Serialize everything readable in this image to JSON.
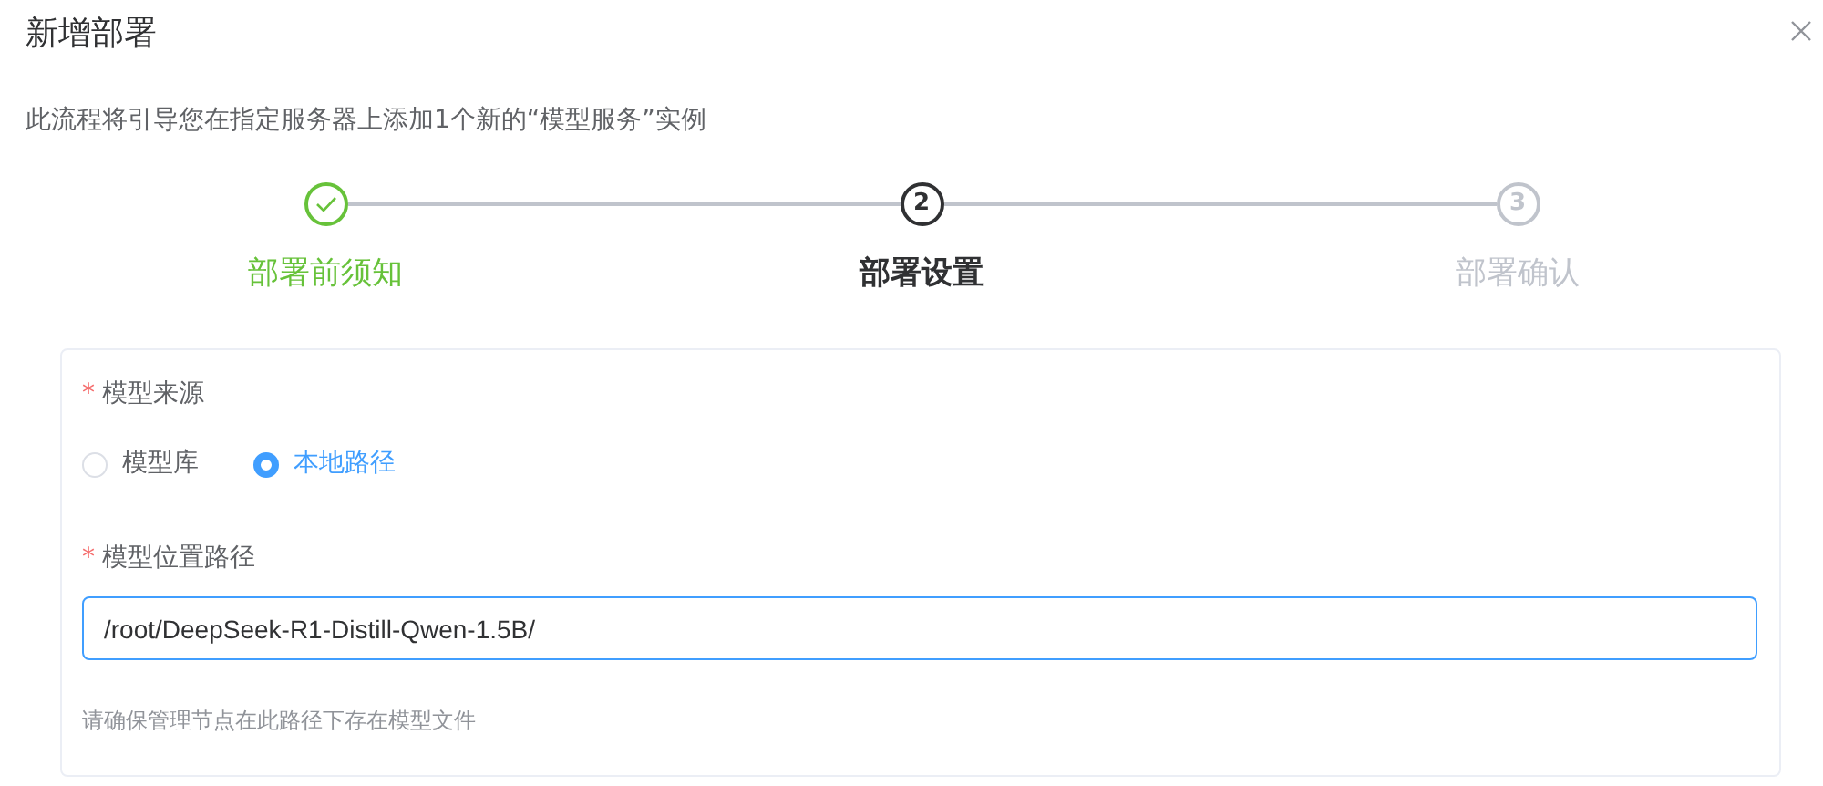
{
  "dialog": {
    "title": "新增部署",
    "description": "此流程将引导您在指定服务器上添加1个新的“模型服务”实例"
  },
  "steps": [
    {
      "label": "部署前须知",
      "completed": true,
      "selected": false
    },
    {
      "number": "2",
      "label": "部署设置",
      "completed": false,
      "selected": true
    },
    {
      "number": "3",
      "label": "部署确认",
      "completed": false,
      "selected": false
    }
  ],
  "form": {
    "source": {
      "required_mark": "*",
      "label": "模型来源",
      "options": [
        {
          "label": "模型库",
          "selected": false
        },
        {
          "label": "本地路径",
          "selected": true
        }
      ]
    },
    "path": {
      "required_mark": "*",
      "label": "模型位置路径",
      "value": "/root/DeepSeek-R1-Distill-Qwen-1.5B/",
      "focused": true,
      "hint": "请确保管理节点在此路径下存在模型文件"
    }
  }
}
